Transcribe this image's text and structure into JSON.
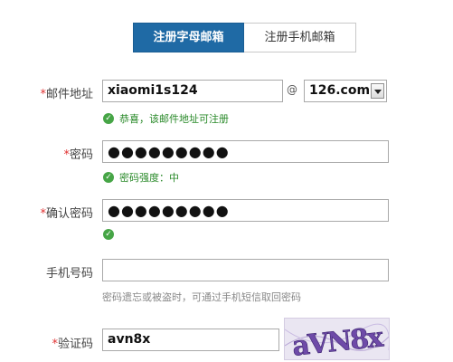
{
  "tabs": {
    "active": "注册字母邮箱",
    "inactive": "注册手机邮箱"
  },
  "email": {
    "required_mark": "*",
    "label": "邮件地址",
    "value": "xiaomi1s124",
    "at": "@",
    "domain": "126.com",
    "hint": "恭喜，该邮件地址可注册"
  },
  "password": {
    "required_mark": "*",
    "label": "密码",
    "value": "●●●●●●●●●",
    "hint": "密码强度：中"
  },
  "confirm": {
    "required_mark": "*",
    "label": "确认密码",
    "value": "●●●●●●●●●"
  },
  "phone": {
    "label": "手机号码",
    "value": "",
    "hint": "密码遗忘或被盗时，可通过手机短信取回密码"
  },
  "captcha": {
    "required_mark": "*",
    "label": "验证码",
    "value": "avn8x",
    "image_text": "aVN8x"
  },
  "colors": {
    "accent": "#1f6aa5",
    "required": "#e03030",
    "success": "#46a546"
  },
  "icons": {
    "ok": "check-circle-icon",
    "dropdown": "chevron-down-icon"
  }
}
